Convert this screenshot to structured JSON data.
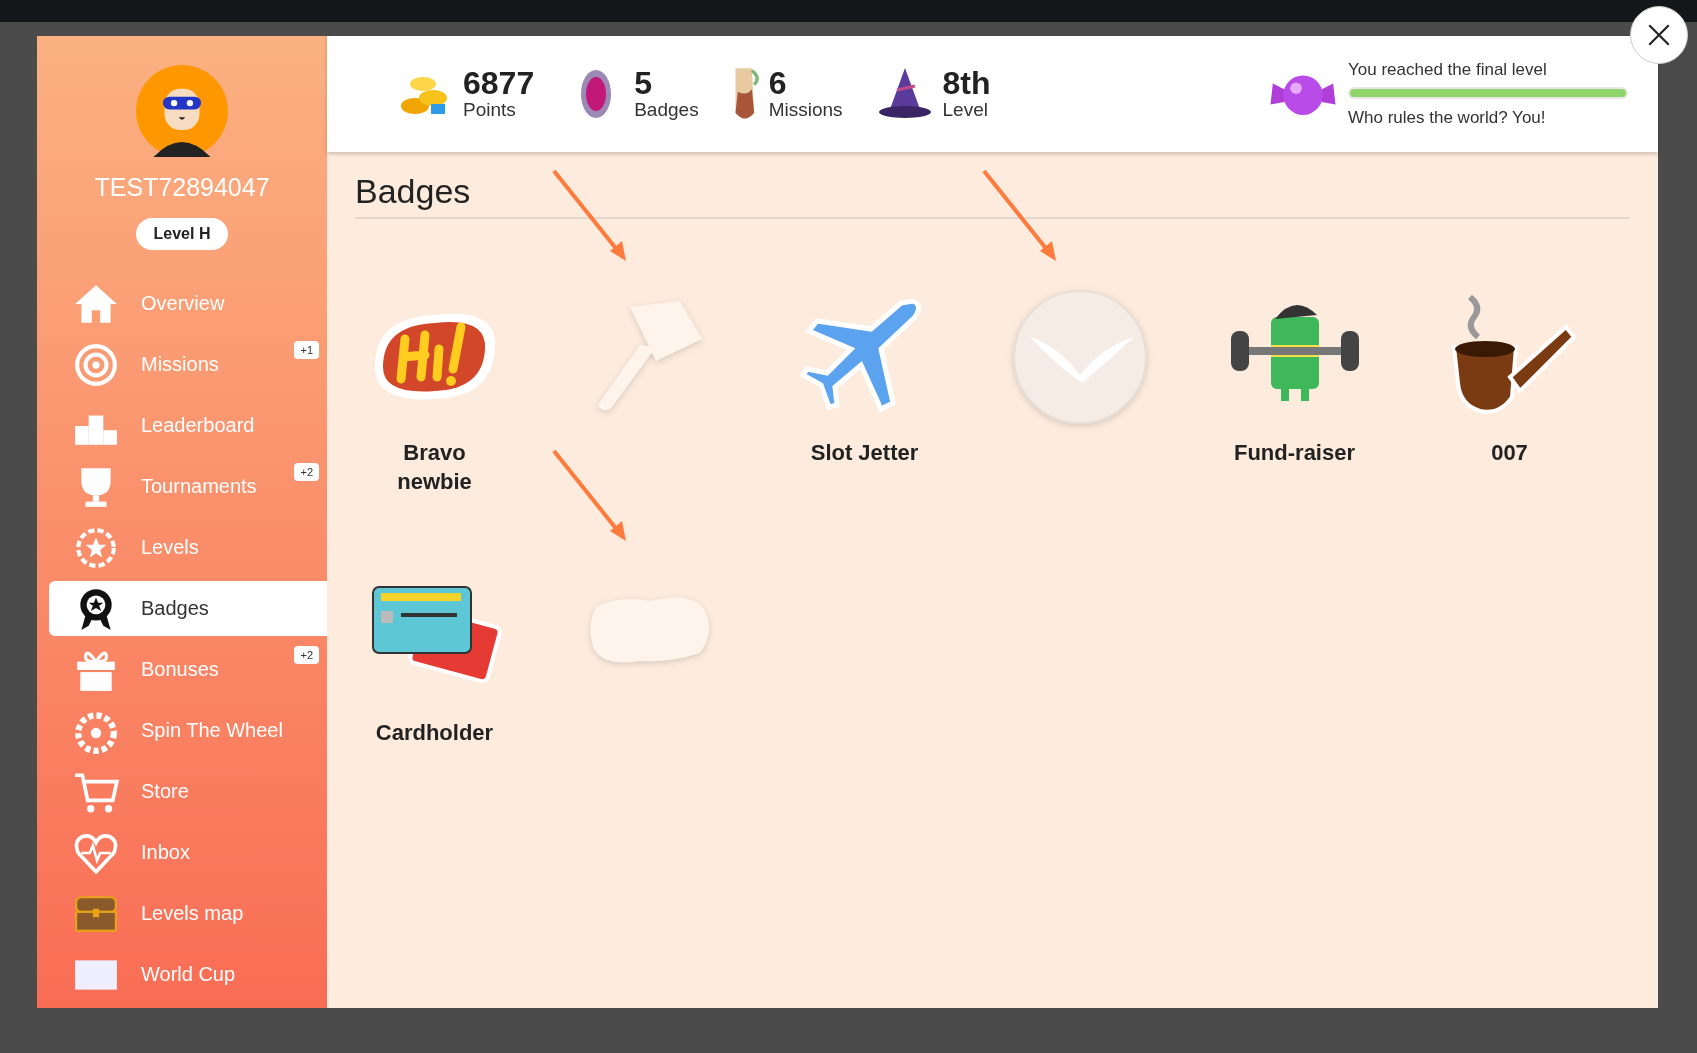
{
  "profile": {
    "username": "TEST72894047",
    "level": "Level H"
  },
  "sidebar": {
    "items": [
      {
        "label": "Overview",
        "selected": false
      },
      {
        "label": "Missions",
        "selected": false,
        "badge": "+1"
      },
      {
        "label": "Leaderboard",
        "selected": false
      },
      {
        "label": "Tournaments",
        "selected": false,
        "badge": "+2"
      },
      {
        "label": "Levels",
        "selected": false
      },
      {
        "label": "Badges",
        "selected": true
      },
      {
        "label": "Bonuses",
        "selected": false,
        "badge": "+2"
      },
      {
        "label": "Spin The Wheel",
        "selected": false
      },
      {
        "label": "Store",
        "selected": false
      },
      {
        "label": "Inbox",
        "selected": false
      },
      {
        "label": "Levels map",
        "selected": false
      },
      {
        "label": "World Cup",
        "selected": false
      }
    ]
  },
  "stats": [
    {
      "value": "6877",
      "label": "Points"
    },
    {
      "value": "5",
      "label": "Badges"
    },
    {
      "value": "6",
      "label": "Missions"
    },
    {
      "value": "8th",
      "label": "Level"
    }
  ],
  "progress": {
    "title": "You reached the final level",
    "level": 1.0,
    "caption": "Who rules the world? You!"
  },
  "page_title": "Badges",
  "badges": [
    {
      "kind": "earned",
      "name": "Bravo newbie",
      "arrow": false
    },
    {
      "kind": "locked",
      "arrow": true
    },
    {
      "kind": "earned",
      "name": "Slot Jetter",
      "arrow": false
    },
    {
      "kind": "locked",
      "arrow": true
    },
    {
      "kind": "earned",
      "name": "Fund-raiser",
      "arrow": false
    },
    {
      "kind": "earned",
      "name": "007",
      "arrow": false
    },
    {
      "kind": "earned",
      "name": "Cardholder",
      "arrow": false
    },
    {
      "kind": "locked",
      "arrow": true
    }
  ]
}
